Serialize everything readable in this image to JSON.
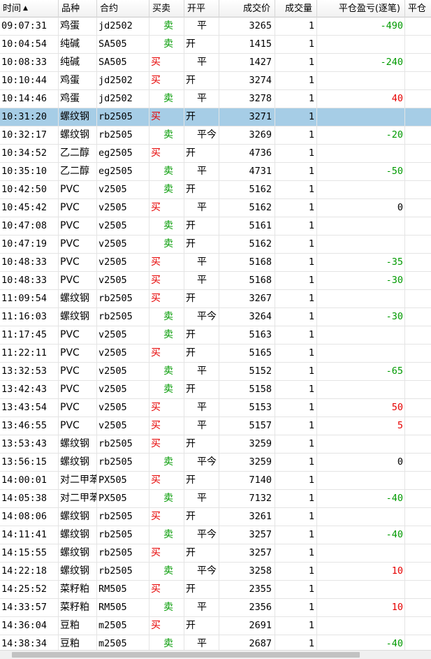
{
  "columns": {
    "time": "时间",
    "product": "品种",
    "contract": "合约",
    "side": "买卖",
    "open_close": "开平",
    "price": "成交价",
    "volume": "成交量",
    "pnl": "平仓盈亏(逐笔)",
    "extra": "平仓"
  },
  "sort": {
    "column": "time",
    "direction": "ascending",
    "icon": "sort-up-arrow-icon"
  },
  "colors": {
    "buy": "#e60000",
    "sell": "#009a00",
    "selected_row": "#a6cde6"
  },
  "selected_index": 5,
  "rows": [
    {
      "time": "09:07:31",
      "product": "鸡蛋",
      "contract": "jd2502",
      "side": "卖",
      "oc": "平",
      "price": "3265",
      "volume": "1",
      "pnl": "-490"
    },
    {
      "time": "10:04:54",
      "product": "纯碱",
      "contract": "SA505",
      "side": "卖",
      "oc": "开",
      "price": "1415",
      "volume": "1",
      "pnl": ""
    },
    {
      "time": "10:08:33",
      "product": "纯碱",
      "contract": "SA505",
      "side": "买",
      "oc": "平",
      "price": "1427",
      "volume": "1",
      "pnl": "-240"
    },
    {
      "time": "10:10:44",
      "product": "鸡蛋",
      "contract": "jd2502",
      "side": "买",
      "oc": "开",
      "price": "3274",
      "volume": "1",
      "pnl": ""
    },
    {
      "time": "10:14:46",
      "product": "鸡蛋",
      "contract": "jd2502",
      "side": "卖",
      "oc": "平",
      "price": "3278",
      "volume": "1",
      "pnl": "40"
    },
    {
      "time": "10:31:20",
      "product": "螺纹钢",
      "contract": "rb2505",
      "side": "买",
      "oc": "开",
      "price": "3271",
      "volume": "1",
      "pnl": ""
    },
    {
      "time": "10:32:17",
      "product": "螺纹钢",
      "contract": "rb2505",
      "side": "卖",
      "oc": "平今",
      "price": "3269",
      "volume": "1",
      "pnl": "-20"
    },
    {
      "time": "10:34:52",
      "product": "乙二醇",
      "contract": "eg2505",
      "side": "买",
      "oc": "开",
      "price": "4736",
      "volume": "1",
      "pnl": ""
    },
    {
      "time": "10:35:10",
      "product": "乙二醇",
      "contract": "eg2505",
      "side": "卖",
      "oc": "平",
      "price": "4731",
      "volume": "1",
      "pnl": "-50"
    },
    {
      "time": "10:42:50",
      "product": "PVC",
      "contract": "v2505",
      "side": "卖",
      "oc": "开",
      "price": "5162",
      "volume": "1",
      "pnl": ""
    },
    {
      "time": "10:45:42",
      "product": "PVC",
      "contract": "v2505",
      "side": "买",
      "oc": "平",
      "price": "5162",
      "volume": "1",
      "pnl": "0"
    },
    {
      "time": "10:47:08",
      "product": "PVC",
      "contract": "v2505",
      "side": "卖",
      "oc": "开",
      "price": "5161",
      "volume": "1",
      "pnl": ""
    },
    {
      "time": "10:47:19",
      "product": "PVC",
      "contract": "v2505",
      "side": "卖",
      "oc": "开",
      "price": "5162",
      "volume": "1",
      "pnl": ""
    },
    {
      "time": "10:48:33",
      "product": "PVC",
      "contract": "v2505",
      "side": "买",
      "oc": "平",
      "price": "5168",
      "volume": "1",
      "pnl": "-35"
    },
    {
      "time": "10:48:33",
      "product": "PVC",
      "contract": "v2505",
      "side": "买",
      "oc": "平",
      "price": "5168",
      "volume": "1",
      "pnl": "-30"
    },
    {
      "time": "11:09:54",
      "product": "螺纹钢",
      "contract": "rb2505",
      "side": "买",
      "oc": "开",
      "price": "3267",
      "volume": "1",
      "pnl": ""
    },
    {
      "time": "11:16:03",
      "product": "螺纹钢",
      "contract": "rb2505",
      "side": "卖",
      "oc": "平今",
      "price": "3264",
      "volume": "1",
      "pnl": "-30"
    },
    {
      "time": "11:17:45",
      "product": "PVC",
      "contract": "v2505",
      "side": "卖",
      "oc": "开",
      "price": "5163",
      "volume": "1",
      "pnl": ""
    },
    {
      "time": "11:22:11",
      "product": "PVC",
      "contract": "v2505",
      "side": "买",
      "oc": "开",
      "price": "5165",
      "volume": "1",
      "pnl": ""
    },
    {
      "time": "13:32:53",
      "product": "PVC",
      "contract": "v2505",
      "side": "卖",
      "oc": "平",
      "price": "5152",
      "volume": "1",
      "pnl": "-65"
    },
    {
      "time": "13:42:43",
      "product": "PVC",
      "contract": "v2505",
      "side": "卖",
      "oc": "开",
      "price": "5158",
      "volume": "1",
      "pnl": ""
    },
    {
      "time": "13:43:54",
      "product": "PVC",
      "contract": "v2505",
      "side": "买",
      "oc": "平",
      "price": "5153",
      "volume": "1",
      "pnl": "50"
    },
    {
      "time": "13:46:55",
      "product": "PVC",
      "contract": "v2505",
      "side": "买",
      "oc": "平",
      "price": "5157",
      "volume": "1",
      "pnl": "5"
    },
    {
      "time": "13:53:43",
      "product": "螺纹钢",
      "contract": "rb2505",
      "side": "买",
      "oc": "开",
      "price": "3259",
      "volume": "1",
      "pnl": ""
    },
    {
      "time": "13:56:15",
      "product": "螺纹钢",
      "contract": "rb2505",
      "side": "卖",
      "oc": "平今",
      "price": "3259",
      "volume": "1",
      "pnl": "0"
    },
    {
      "time": "14:00:01",
      "product": "对二甲苯",
      "contract": "PX505",
      "side": "买",
      "oc": "开",
      "price": "7140",
      "volume": "1",
      "pnl": ""
    },
    {
      "time": "14:05:38",
      "product": "对二甲苯",
      "contract": "PX505",
      "side": "卖",
      "oc": "平",
      "price": "7132",
      "volume": "1",
      "pnl": "-40"
    },
    {
      "time": "14:08:06",
      "product": "螺纹钢",
      "contract": "rb2505",
      "side": "买",
      "oc": "开",
      "price": "3261",
      "volume": "1",
      "pnl": ""
    },
    {
      "time": "14:11:41",
      "product": "螺纹钢",
      "contract": "rb2505",
      "side": "卖",
      "oc": "平今",
      "price": "3257",
      "volume": "1",
      "pnl": "-40"
    },
    {
      "time": "14:15:55",
      "product": "螺纹钢",
      "contract": "rb2505",
      "side": "买",
      "oc": "开",
      "price": "3257",
      "volume": "1",
      "pnl": ""
    },
    {
      "time": "14:22:18",
      "product": "螺纹钢",
      "contract": "rb2505",
      "side": "卖",
      "oc": "平今",
      "price": "3258",
      "volume": "1",
      "pnl": "10"
    },
    {
      "time": "14:25:52",
      "product": "菜籽粕",
      "contract": "RM505",
      "side": "买",
      "oc": "开",
      "price": "2355",
      "volume": "1",
      "pnl": ""
    },
    {
      "time": "14:33:57",
      "product": "菜籽粕",
      "contract": "RM505",
      "side": "卖",
      "oc": "平",
      "price": "2356",
      "volume": "1",
      "pnl": "10"
    },
    {
      "time": "14:36:04",
      "product": "豆粕",
      "contract": "m2505",
      "side": "买",
      "oc": "开",
      "price": "2691",
      "volume": "1",
      "pnl": ""
    },
    {
      "time": "14:38:34",
      "product": "豆粕",
      "contract": "m2505",
      "side": "卖",
      "oc": "平",
      "price": "2687",
      "volume": "1",
      "pnl": "-40"
    }
  ]
}
